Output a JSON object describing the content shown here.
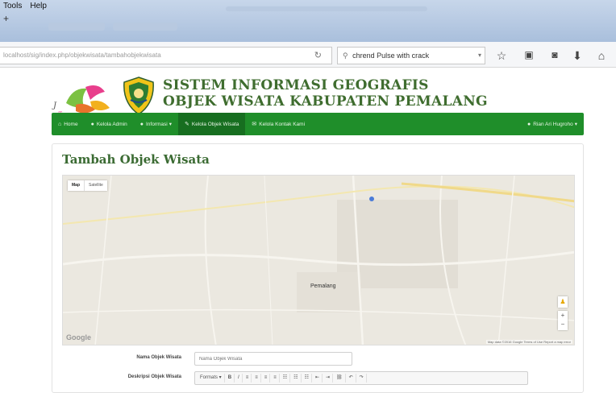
{
  "browser": {
    "menu": [
      "Tools",
      "Help"
    ],
    "new_tab_symbol": "+",
    "url": "localhost/sig/index.php/objekwisata/tambahobjekwisata",
    "search_text": "chrend Pulse with crack",
    "icons": [
      "reload-icon",
      "search-icon",
      "star-icon",
      "clipboard-icon",
      "pocket-icon",
      "download-icon",
      "home-icon"
    ]
  },
  "site": {
    "title_line1": "SISTEM INFORMASI GEOGRAFIS",
    "title_line2": "OBJEK WISATA KABUPATEN PEMALANG",
    "colors": {
      "navbar": "#1f8e2a",
      "title": "#3f6d2f"
    }
  },
  "nav": {
    "items": [
      {
        "label": "Home",
        "icon": "home-icon"
      },
      {
        "label": "Kelola Admin",
        "icon": "user-icon"
      },
      {
        "label": "Informasi",
        "icon": "info-icon"
      },
      {
        "label": "Kelola Objek Wisata",
        "icon": "pencil-icon",
        "active": true
      },
      {
        "label": "Kelola Kontak Kami",
        "icon": "envelope-icon"
      }
    ],
    "user_label": "Rian Ari Hugroho"
  },
  "panel": {
    "title": "Tambah Objek Wisata"
  },
  "map": {
    "type_map": "Map",
    "type_satellite": "Satellite",
    "place_label": "Pemalang",
    "google": "Google",
    "footer": "Map data ©2016 Google   Terms of Use   Report a map error"
  },
  "form": {
    "name_label": "Nama Objek Wisata",
    "name_placeholder": "Nama Objek Wisata",
    "desc_label": "Deskripsi Objek Wisata",
    "toolbar": [
      "Formats",
      "B",
      "I",
      "≡",
      "≡",
      "≡",
      "≡",
      "☷",
      "☷",
      "☷",
      "⇤",
      "⇥",
      "⛓",
      "↶",
      "↷"
    ]
  }
}
